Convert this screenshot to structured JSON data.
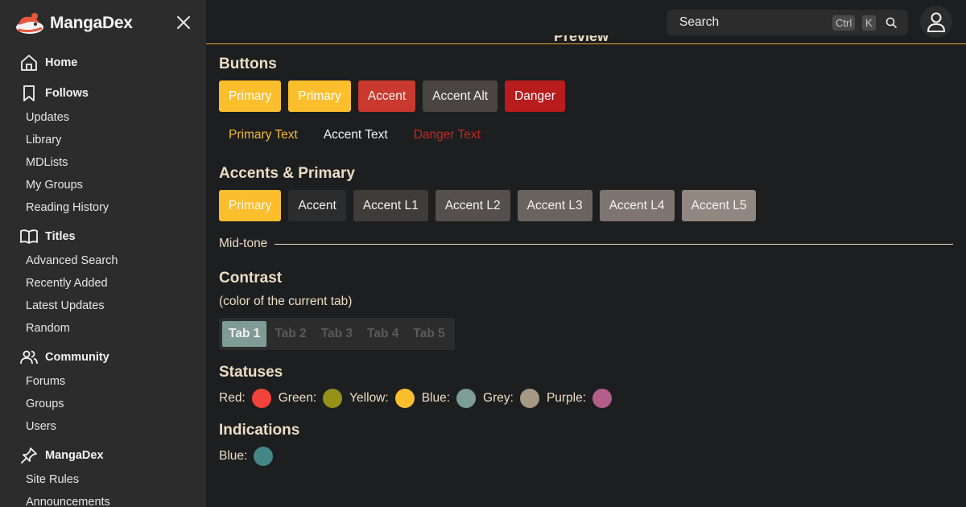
{
  "sidebar": {
    "logo_text": "MangaDex",
    "sections": [
      {
        "label": "Home",
        "icon": "home-icon",
        "items": []
      },
      {
        "label": "Follows",
        "icon": "bookmark-icon",
        "items": [
          "Updates",
          "Library",
          "MDLists",
          "My Groups",
          "Reading History"
        ]
      },
      {
        "label": "Titles",
        "icon": "book-icon",
        "items": [
          "Advanced Search",
          "Recently Added",
          "Latest Updates",
          "Random"
        ]
      },
      {
        "label": "Community",
        "icon": "users-icon",
        "items": [
          "Forums",
          "Groups",
          "Users"
        ]
      },
      {
        "label": "MangaDex",
        "icon": "pin-icon",
        "items": [
          "Site Rules",
          "Announcements"
        ]
      }
    ]
  },
  "header": {
    "search_placeholder": "Search",
    "shortcut_keys": [
      "Ctrl",
      "K"
    ],
    "preview_label": "Preview"
  },
  "buttons": {
    "title": "Buttons",
    "filled": [
      {
        "label": "Primary",
        "bg": "#fbbf2d",
        "fg": "#ffffff"
      },
      {
        "label": "Primary",
        "bg": "#fbbf2d",
        "fg": "#ffffff"
      },
      {
        "label": "Accent",
        "bg": "#c9392e",
        "fg": "#f4f4f4"
      },
      {
        "label": "Accent Alt",
        "bg": "#4a4543",
        "fg": "#f4f4f4"
      },
      {
        "label": "Danger",
        "bg": "#b91c1c",
        "fg": "#ffffff"
      }
    ],
    "text": [
      {
        "label": "Primary Text",
        "fg": "#f5b934"
      },
      {
        "label": "Accent Text",
        "fg": "#f2f2f2"
      },
      {
        "label": "Danger Text",
        "fg": "#c22a22"
      }
    ]
  },
  "accents": {
    "title": "Accents & Primary",
    "swatches": [
      {
        "label": "Primary",
        "bg": "#fbbf2d",
        "fg": "#f7f7f7"
      },
      {
        "label": "Accent",
        "bg": "#2c2c2c",
        "fg": "#f2f2f2"
      },
      {
        "label": "Accent L1",
        "bg": "#403c3a",
        "fg": "#f2f2f2"
      },
      {
        "label": "Accent L2",
        "bg": "#55504d",
        "fg": "#f2f2f2"
      },
      {
        "label": "Accent L3",
        "bg": "#6b635e",
        "fg": "#f2f2f2"
      },
      {
        "label": "Accent L4",
        "bg": "#7e7570",
        "fg": "#f2f2f2"
      },
      {
        "label": "Accent L5",
        "bg": "#918781",
        "fg": "#f2f2f2"
      }
    ],
    "midtone_label": "Mid-tone"
  },
  "contrast": {
    "title": "Contrast",
    "subtitle": "(color of the current tab)",
    "tabs": [
      "Tab 1",
      "Tab 2",
      "Tab 3",
      "Tab 4",
      "Tab 5"
    ],
    "active_index": 0
  },
  "statuses": {
    "title": "Statuses",
    "items": [
      {
        "label": "Red:",
        "color": "#f2433a"
      },
      {
        "label": "Green:",
        "color": "#969119"
      },
      {
        "label": "Yellow:",
        "color": "#fbbf2d"
      },
      {
        "label": "Blue:",
        "color": "#7d9d96"
      },
      {
        "label": "Grey:",
        "color": "#a59985"
      },
      {
        "label": "Purple:",
        "color": "#b35e8a"
      }
    ]
  },
  "indications": {
    "title": "Indications",
    "items": [
      {
        "label": "Blue:",
        "color": "#458686"
      }
    ]
  }
}
